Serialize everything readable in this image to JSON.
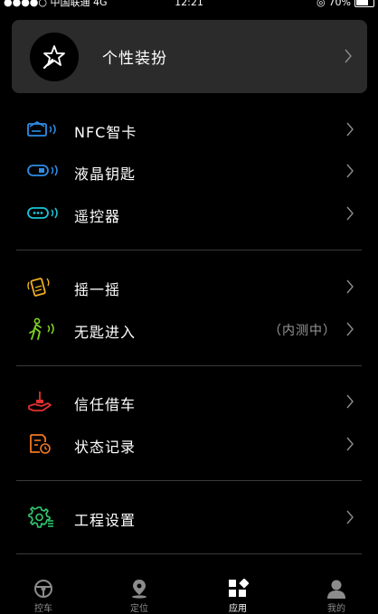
{
  "status_bar": {
    "carrier": "●●●●○ 中国联通",
    "network": "4G",
    "time": "12:21",
    "battery": "70%",
    "battery_level": 0.7
  },
  "profile": {
    "label": "个性装扮",
    "icon": "magic-wand-star-icon"
  },
  "groups": [
    [
      {
        "label": "NFC智卡",
        "icon": "nfc-card-icon",
        "color": "#2e8ce6"
      },
      {
        "label": "液晶钥匙",
        "icon": "lcd-key-icon",
        "color": "#2e8ce6"
      },
      {
        "label": "遥控器",
        "icon": "remote-control-icon",
        "color": "#19c4d8"
      }
    ],
    [
      {
        "label": "摇一摇",
        "icon": "shake-hand-icon",
        "color": "#f0b020"
      },
      {
        "label": "无匙进入",
        "icon": "walking-person-icon",
        "color": "#7ed321",
        "note": "（内测中）"
      }
    ],
    [
      {
        "label": "信任借车",
        "icon": "hand-key-icon",
        "color": "#e03030"
      },
      {
        "label": "状态记录",
        "icon": "record-icon",
        "color": "#f07820"
      }
    ],
    [
      {
        "label": "工程设置",
        "icon": "engineering-gear-icon",
        "color": "#2ecc71"
      }
    ]
  ],
  "tabs": [
    {
      "label": "控车",
      "icon": "steering-wheel-icon",
      "active": false
    },
    {
      "label": "定位",
      "icon": "location-pin-icon",
      "active": false
    },
    {
      "label": "应用",
      "icon": "apps-grid-icon",
      "active": true
    },
    {
      "label": "我的",
      "icon": "user-icon",
      "active": false
    }
  ]
}
